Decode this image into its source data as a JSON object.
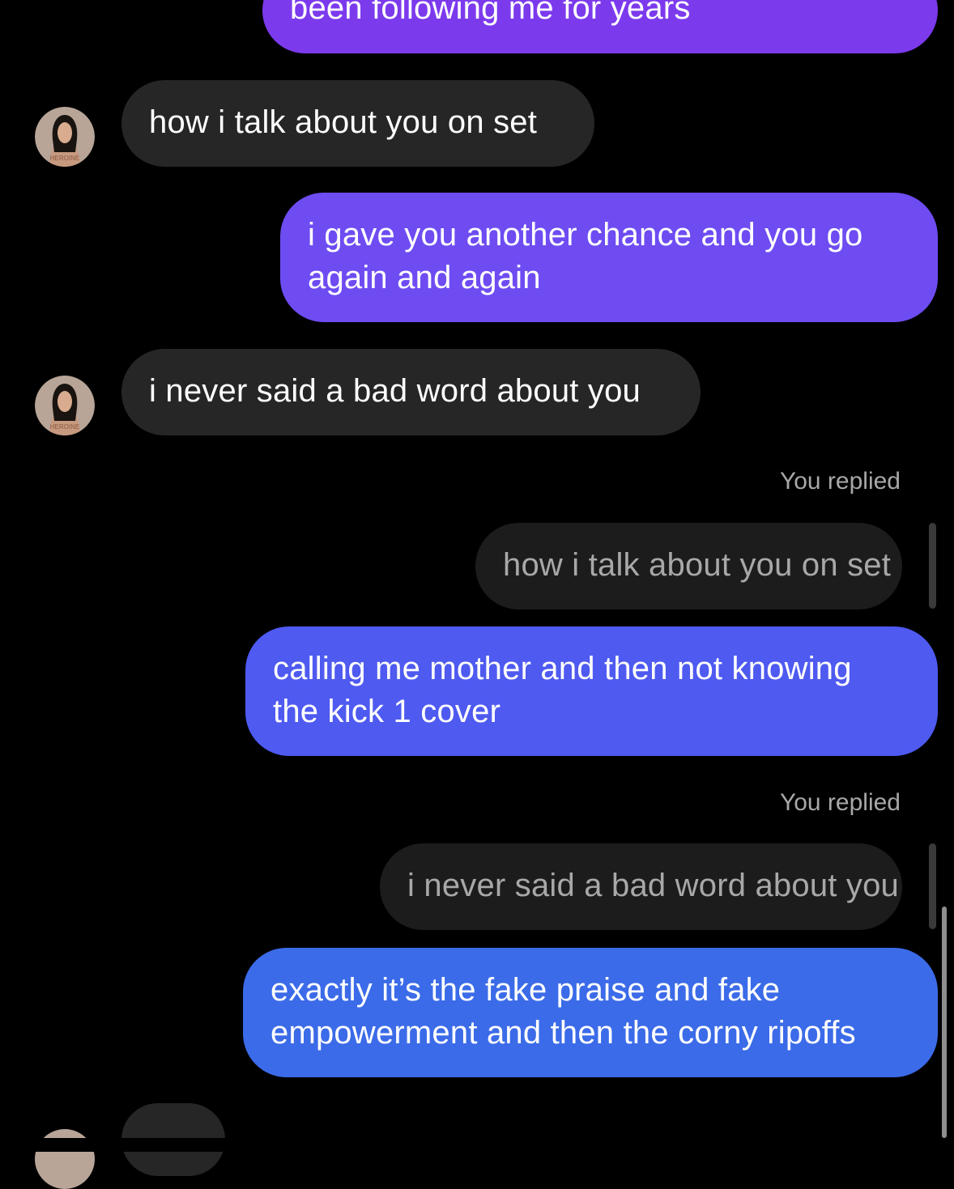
{
  "messages": {
    "m0_sent": "been following me for years",
    "m1_received": "how i talk about you on set",
    "m2_sent_line1": "i gave you another chance and you go",
    "m2_sent_line2": "again and again",
    "m3_received": "i never said a bad word about you",
    "reply1_label": "You replied",
    "reply1_quote": "how i talk about you on set",
    "m4_sent_line1": "calling me mother and then not knowing",
    "m4_sent_line2": "the kick 1 cover",
    "reply2_label": "You replied",
    "reply2_quote": "i never said a bad word about you",
    "m5_sent_line1": "exactly it’s the fake praise and fake",
    "m5_sent_line2": "empowerment and then the corny ripoffs"
  },
  "avatar": {
    "icon": "contact-avatar",
    "overlay_text": "HEROINE"
  },
  "colors": {
    "background": "#000000",
    "received_bubble": "#262626",
    "sent_purple_top": "#8a3cf0",
    "sent_violet": "#6e4cf2",
    "sent_indigo": "#4e5af0",
    "sent_blue": "#3b6be8",
    "muted_text": "#a8a8a8"
  }
}
